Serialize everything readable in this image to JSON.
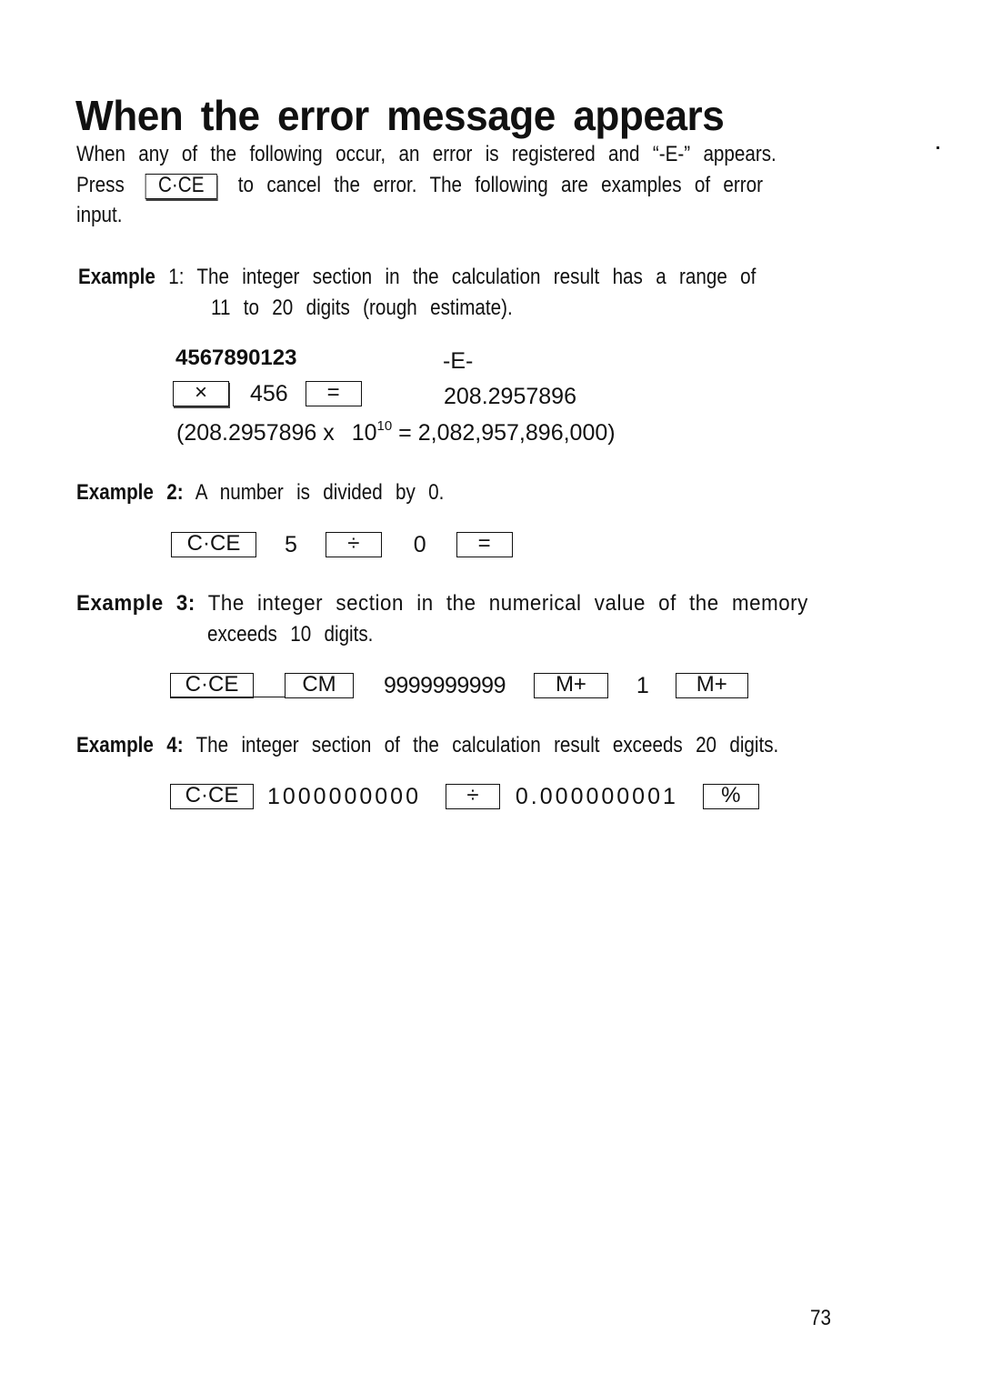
{
  "title": "When the error message appears",
  "intro": {
    "line1_prefix": "When any of the following occur, an error is registered and",
    "error_symbol_quoted": "“-E-”",
    "line1_suffix": "appears.",
    "line2_prefix": "Press",
    "key": "C·CE",
    "line2_suffix": "to cancel the error. The following are examples of error",
    "line3": "input."
  },
  "examples": [
    {
      "label": "Example",
      "number": "1:",
      "text_line1": "The integer section in the calculation result has a range of",
      "text_line2": "11 to 20 digits (rough estimate).",
      "entry": "4567890123",
      "entry_display": "-E-",
      "seq": {
        "key1": "×",
        "value": "456",
        "key2": "=",
        "display": "208.2957896"
      },
      "note": {
        "open": "(208.2957896 x",
        "base": "10",
        "exp": "10",
        "result": "= 2,082,957,896,000)"
      }
    },
    {
      "label": "Example",
      "number": "2:",
      "text_line1": "A number is divided by 0.",
      "seq": {
        "key1": "C·CE",
        "v1": "5",
        "key2": "÷",
        "v2": "0",
        "key3": "="
      }
    },
    {
      "label": "Example 3:",
      "text_line1": "The integer section in the numerical value of the memory",
      "text_line2": "exceeds 10 digits.",
      "seq": {
        "key1": "C·CE",
        "key2": "CM",
        "v1": "9999999999",
        "key3": "M+",
        "v2": "1",
        "key4": "M+"
      }
    },
    {
      "label": "Example",
      "number": "4:",
      "text_line1": "The integer section of the calculation result exceeds 20 digits.",
      "seq": {
        "key1": "C·CE",
        "v1": "1000000000",
        "key2": "÷",
        "v2": "0.000000001",
        "key3": "%"
      }
    }
  ],
  "page_number": "73"
}
